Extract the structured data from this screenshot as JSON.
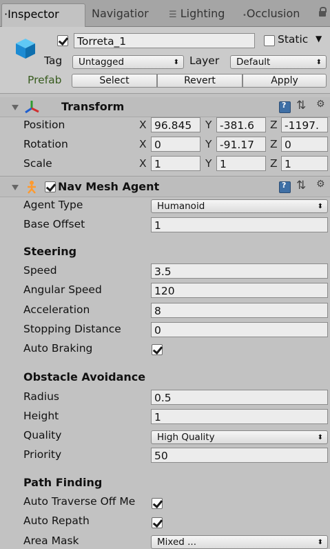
{
  "tabs": [
    "Inspector",
    "Navigatior",
    "Lighting",
    "Occlusion"
  ],
  "object": {
    "name": "Torreta_1",
    "static_label": "Static",
    "tag_label": "Tag",
    "tag_value": "Untagged",
    "layer_label": "Layer",
    "layer_value": "Default",
    "prefab_label": "Prefab",
    "prefab_buttons": [
      "Select",
      "Revert",
      "Apply"
    ]
  },
  "transform": {
    "title": "Transform",
    "rows": [
      {
        "label": "Position",
        "x": "96.845",
        "y": "-381.6",
        "z": "-1197."
      },
      {
        "label": "Rotation",
        "x": "0",
        "y": "-91.17",
        "z": "0"
      },
      {
        "label": "Scale",
        "x": "1",
        "y": "1",
        "z": "1"
      }
    ],
    "axes": [
      "X",
      "Y",
      "Z"
    ]
  },
  "nav_mesh_agent": {
    "title": "Nav Mesh Agent",
    "agent_type_label": "Agent Type",
    "agent_type_value": "Humanoid",
    "base_offset_label": "Base Offset",
    "base_offset_value": "1",
    "steering": {
      "title": "Steering",
      "speed_label": "Speed",
      "speed_value": "3.5",
      "angular_speed_label": "Angular Speed",
      "angular_speed_value": "120",
      "acceleration_label": "Acceleration",
      "acceleration_value": "8",
      "stopping_distance_label": "Stopping Distance",
      "stopping_distance_value": "0",
      "auto_braking_label": "Auto Braking"
    },
    "obstacle_avoidance": {
      "title": "Obstacle Avoidance",
      "radius_label": "Radius",
      "radius_value": "0.5",
      "height_label": "Height",
      "height_value": "1",
      "quality_label": "Quality",
      "quality_value": "High Quality",
      "priority_label": "Priority",
      "priority_value": "50"
    },
    "path_finding": {
      "title": "Path Finding",
      "auto_traverse_label": "Auto Traverse Off Me",
      "auto_repath_label": "Auto Repath",
      "area_mask_label": "Area Mask",
      "area_mask_value": "Mixed ..."
    }
  }
}
